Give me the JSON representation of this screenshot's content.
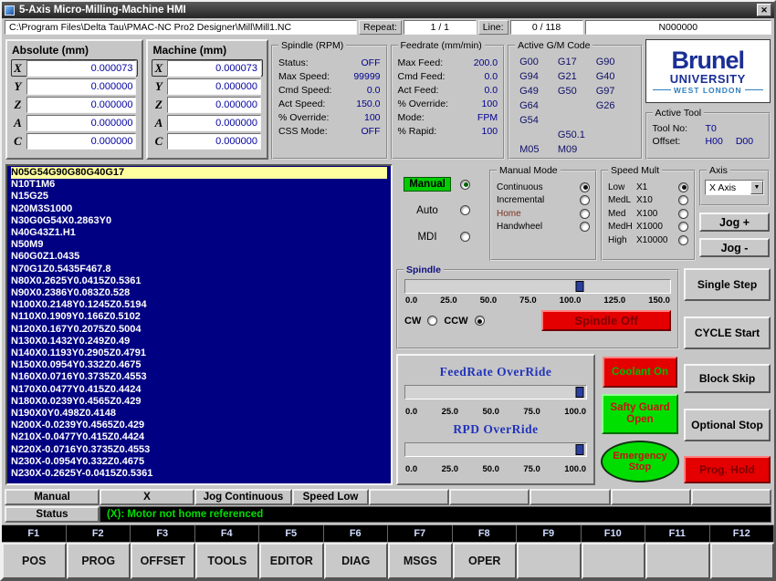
{
  "window": {
    "title": "5-Axis Micro-Milling-Machine HMI",
    "close_glyph": "✕"
  },
  "pathbar": {
    "path": "C:\\Program Files\\Delta Tau\\PMAC-NC Pro2 Designer\\Mill\\Mill1.NC",
    "repeat_label": "Repeat:",
    "repeat_value": "1 / 1",
    "line_label": "Line:",
    "line_value": "0 / 118",
    "block_number": "N000000"
  },
  "absolute": {
    "title": "Absolute (mm)",
    "axes": [
      {
        "axis": "X",
        "value": "0.000073",
        "on": true
      },
      {
        "axis": "Y",
        "value": "0.000000",
        "on": false
      },
      {
        "axis": "Z",
        "value": "0.000000",
        "on": false
      },
      {
        "axis": "A",
        "value": "0.000000",
        "on": false
      },
      {
        "axis": "C",
        "value": "0.000000",
        "on": false
      }
    ]
  },
  "machine": {
    "title": "Machine (mm)",
    "axes": [
      {
        "axis": "X",
        "value": "0.000073",
        "on": true
      },
      {
        "axis": "Y",
        "value": "0.000000",
        "on": false
      },
      {
        "axis": "Z",
        "value": "0.000000",
        "on": false
      },
      {
        "axis": "A",
        "value": "0.000000",
        "on": false
      },
      {
        "axis": "C",
        "value": "0.000000",
        "on": false
      }
    ]
  },
  "spindle_info": {
    "title": "Spindle (RPM)",
    "rows": [
      {
        "label": "Status:",
        "value": "OFF"
      },
      {
        "label": "Max Speed:",
        "value": "99999"
      },
      {
        "label": "Cmd Speed:",
        "value": "0.0"
      },
      {
        "label": "Act Speed:",
        "value": "150.0"
      },
      {
        "label": "% Override:",
        "value": "100"
      },
      {
        "label": "CSS Mode:",
        "value": "OFF"
      }
    ]
  },
  "feedrate_info": {
    "title": "Feedrate (mm/min)",
    "rows": [
      {
        "label": "Max Feed:",
        "value": "200.0"
      },
      {
        "label": "Cmd Feed:",
        "value": "0.0"
      },
      {
        "label": "Act Feed:",
        "value": "0.0"
      },
      {
        "label": "% Override:",
        "value": "100"
      },
      {
        "label": "Mode:",
        "value": "FPM"
      },
      {
        "label": "% Rapid:",
        "value": "100"
      }
    ]
  },
  "gm_panel": {
    "title": "Active G/M Code",
    "codes": [
      "G00",
      "G17",
      "G90",
      "G94",
      "G21",
      "G40",
      "G49",
      "G50",
      "G97",
      "G64",
      "",
      "G26",
      "G54",
      "",
      "",
      "",
      "G50.1",
      "",
      "M05",
      "M09",
      ""
    ]
  },
  "logo": {
    "line1": "Brunel",
    "line2": "UNIVERSITY",
    "line3": "WEST LONDON"
  },
  "active_tool": {
    "title": "Active Tool",
    "tool_label": "Tool No:",
    "tool_value": "T0",
    "offset_label": "Offset:",
    "offset_h": "H00",
    "offset_d": "D00"
  },
  "gcode": {
    "lines": [
      "N05G54G90G80G40G17",
      "N10T1M6",
      "N15G25",
      "N20M3S1000",
      "N30G0G54X0.2863Y0",
      "N40G43Z1.H1",
      "N50M9",
      "N60G0Z1.0435",
      "N70G1Z0.5435F467.8",
      "N80X0.2625Y0.0415Z0.5361",
      "N90X0.2386Y0.083Z0.528",
      "N100X0.2148Y0.1245Z0.5194",
      "N110X0.1909Y0.166Z0.5102",
      "N120X0.167Y0.2075Z0.5004",
      "N130X0.1432Y0.249Z0.49",
      "N140X0.1193Y0.2905Z0.4791",
      "N150X0.0954Y0.332Z0.4675",
      "N160X0.0716Y0.3735Z0.4553",
      "N170X0.0477Y0.415Z0.4424",
      "N180X0.0239Y0.4565Z0.429",
      "N190X0Y0.498Z0.4148",
      "N200X-0.0239Y0.4565Z0.429",
      "N210X-0.0477Y0.415Z0.4424",
      "N220X-0.0716Y0.3735Z0.4553",
      "N230X-0.0954Y0.332Z0.4675",
      "N230X-0.2625Y-0.0415Z0.5361"
    ]
  },
  "mode": {
    "options": [
      {
        "label": "Manual",
        "on": true
      },
      {
        "label": "Auto",
        "on": false
      },
      {
        "label": "MDI",
        "on": false
      }
    ]
  },
  "manual_mode": {
    "title": "Manual Mode",
    "options": [
      {
        "label": "Continuous",
        "on": true
      },
      {
        "label": "Incremental",
        "on": false
      },
      {
        "label": "Home",
        "on": false
      },
      {
        "label": "Handwheel",
        "on": false
      }
    ]
  },
  "speed_mult": {
    "title": "Speed Mult",
    "options": [
      {
        "label": "Low",
        "mult": "X1",
        "on": true
      },
      {
        "label": "MedL",
        "mult": "X10",
        "on": false
      },
      {
        "label": "Med",
        "mult": "X100",
        "on": false
      },
      {
        "label": "MedH",
        "mult": "X1000",
        "on": false
      },
      {
        "label": "High",
        "mult": "X10000",
        "on": false
      }
    ]
  },
  "axis_group": {
    "title": "Axis",
    "selected": "X Axis",
    "jog_plus": "Jog +",
    "jog_minus": "Jog -"
  },
  "spindle_slider": {
    "title": "Spindle",
    "value": 100,
    "max": 150,
    "ticks": [
      "0.0",
      "25.0",
      "50.0",
      "75.0",
      "100.0",
      "125.0",
      "150.0"
    ],
    "cw_label": "CW",
    "ccw_label": "CCW",
    "cw_on": false,
    "ccw_on": true,
    "button": "Spindle Off"
  },
  "feed_override": {
    "title": "FeedRate OverRide",
    "value": 100,
    "max": 100,
    "ticks": [
      "0.0",
      "25.0",
      "50.0",
      "75.0",
      "100.0"
    ]
  },
  "rpd_override": {
    "title": "RPD OverRide",
    "value": 100,
    "max": 100,
    "ticks": [
      "0.0",
      "25.0",
      "50.0",
      "75.0",
      "100.0"
    ]
  },
  "action_buttons": {
    "single_step": "Single Step",
    "cycle_start": "CYCLE Start",
    "block_skip": "Block Skip",
    "optional_stop": "Optional Stop",
    "prog_hold": "Prog. Hold",
    "coolant": "Coolant On",
    "safety_line1": "Safty Guard",
    "safety_line2": "Open",
    "emergency_line1": "Emergency",
    "emergency_line2": "Stop"
  },
  "status_bar": {
    "cells": [
      "Manual",
      "X",
      "Jog Continuous",
      "Speed Low",
      "",
      "",
      "",
      "",
      ""
    ],
    "status_label": "Status",
    "message": "(X): Motor not home referenced"
  },
  "fkeys": [
    "F1",
    "F2",
    "F3",
    "F4",
    "F5",
    "F6",
    "F7",
    "F8",
    "F9",
    "F10",
    "F11",
    "F12"
  ],
  "softkeys": [
    "POS",
    "PROG",
    "OFFSET",
    "TOOLS",
    "EDITOR",
    "DIAG",
    "MSGS",
    "OPER",
    "",
    "",
    "",
    ""
  ]
}
